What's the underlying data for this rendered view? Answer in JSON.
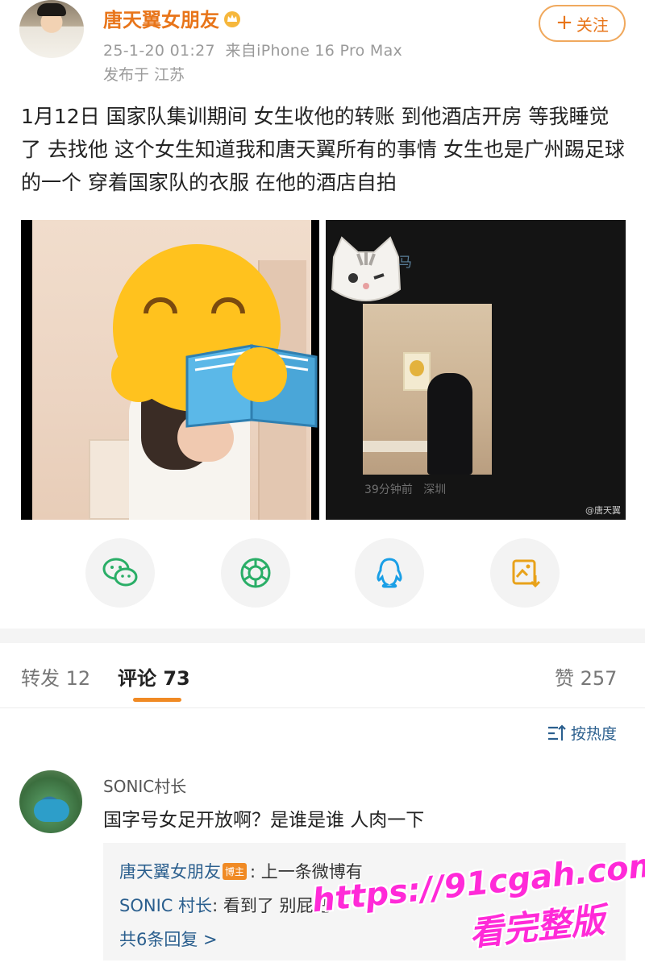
{
  "post": {
    "username": "唐天翼女朋友",
    "timestamp": "25-1-20 01:27",
    "source": "来自iPhone 16 Pro Max",
    "location": "发布于 江苏",
    "follow_label": "关注",
    "follow_plus": "+",
    "text": "1月12日 国家队集训期间 女生收他的转账 到他酒店开房 等我睡觉了 去找他 这个女生知道我和唐天翼所有的事情 女生也是广州踢足球的一个 穿着国家队的衣服 在他的酒店自拍"
  },
  "images": {
    "right_overlay_char": "马",
    "right_time": "39分钟前",
    "right_city": "深圳",
    "right_watermark": "@唐天翼"
  },
  "share": {
    "icons": [
      "wechat-icon",
      "moments-icon",
      "qq-icon",
      "save-image-icon"
    ],
    "colors": {
      "wechat": "#2aae67",
      "moments": "#2aae67",
      "qq": "#1a9fe6",
      "save": "#e8a21a"
    }
  },
  "tabs": {
    "repost": "转发 12",
    "comment": "评论 73",
    "like": "赞 257"
  },
  "sort_label": "按热度",
  "comment": {
    "user": "SONIC村长",
    "text": "国字号女足开放啊？是谁是谁 人肉一下",
    "replies": [
      {
        "user": "唐天翼女朋友",
        "badge": "博主",
        "text": ": 上一条微博有"
      },
      {
        "user": "SONIC 村长",
        "text": ": 看到了 别屁吧"
      }
    ],
    "more": "共6条回复 >"
  },
  "watermark": {
    "url": "https://91cgah.com",
    "subtitle": "看完整版"
  },
  "accent": "#e8751a"
}
